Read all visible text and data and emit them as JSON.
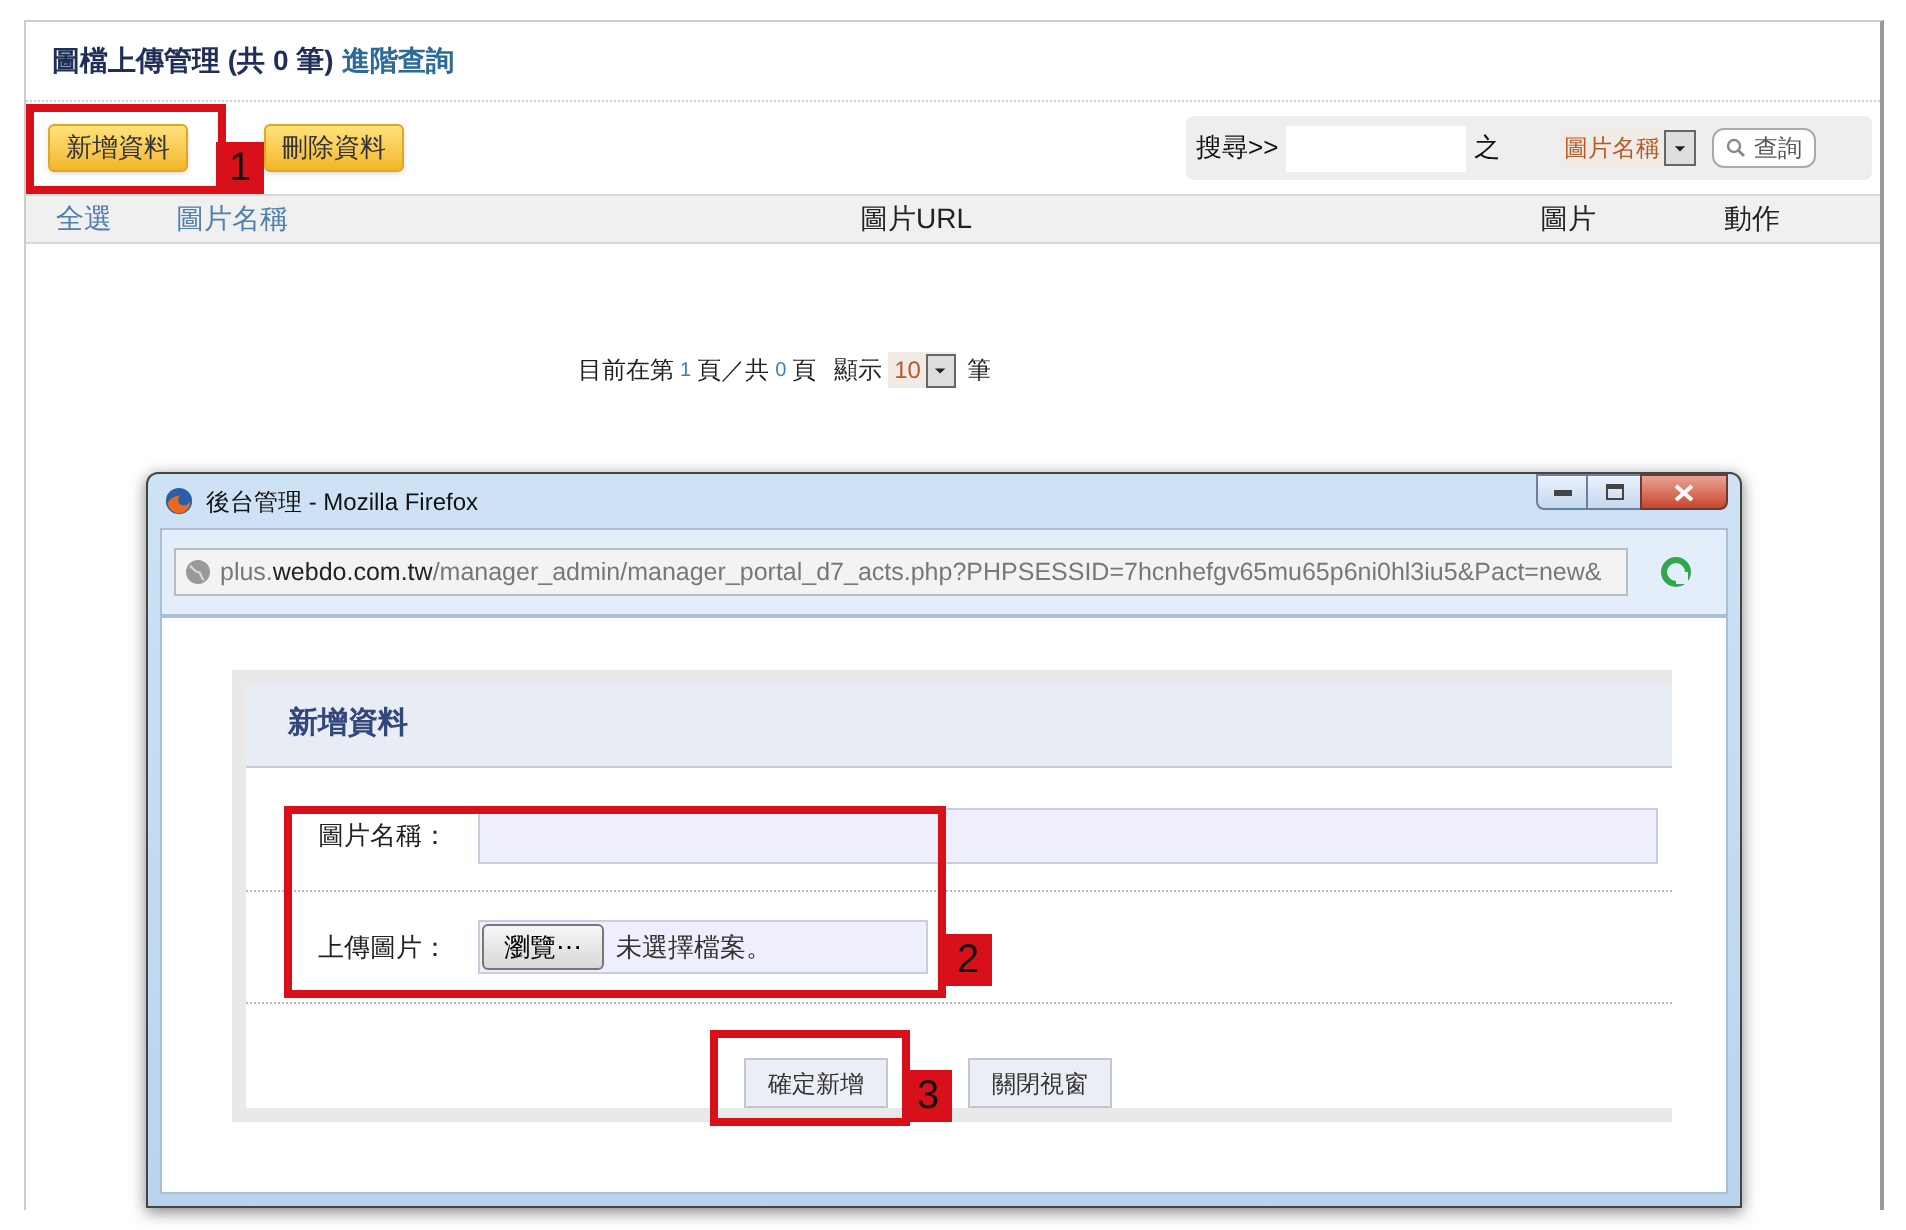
{
  "page": {
    "title": "圖檔上傳管理 (共 0 筆)",
    "advanced_search_link": "進階查詢",
    "buttons": [
      {
        "label": "新增資料"
      },
      {
        "label": "刪除資料"
      }
    ],
    "search": {
      "label": "搜尋>>",
      "suffix": "之",
      "field_select": "圖片名稱",
      "button": "查詢"
    },
    "table": {
      "columns": [
        "全選",
        "圖片名稱",
        "圖片URL",
        "圖片",
        "動作"
      ]
    },
    "pagination": {
      "prefix": "目前在第",
      "current": "1",
      "middle": "頁／共",
      "total": "0",
      "suffix": "頁",
      "show_label": "顯示",
      "page_size": "10",
      "unit": "筆"
    }
  },
  "popup": {
    "title": "後台管理 - Mozilla Firefox",
    "url": "plus.**webdo.com.tw**/manager_admin/manager_portal_d7_acts.php?PHPSESSID=7hcnhefgv65mu65p6ni0hl3iu5&Pact=new&",
    "form": {
      "heading": "新增資料",
      "fields": [
        {
          "kind": "text",
          "label": "圖片名稱："
        },
        {
          "kind": "file",
          "label": "上傳圖片：",
          "button": "瀏覽⋯",
          "status": "未選擇檔案。"
        }
      ],
      "buttons": [
        "確定新增",
        "關閉視窗"
      ]
    }
  },
  "annotations": [
    {
      "label": "1"
    },
    {
      "label": "2"
    },
    {
      "label": "3"
    }
  ]
}
